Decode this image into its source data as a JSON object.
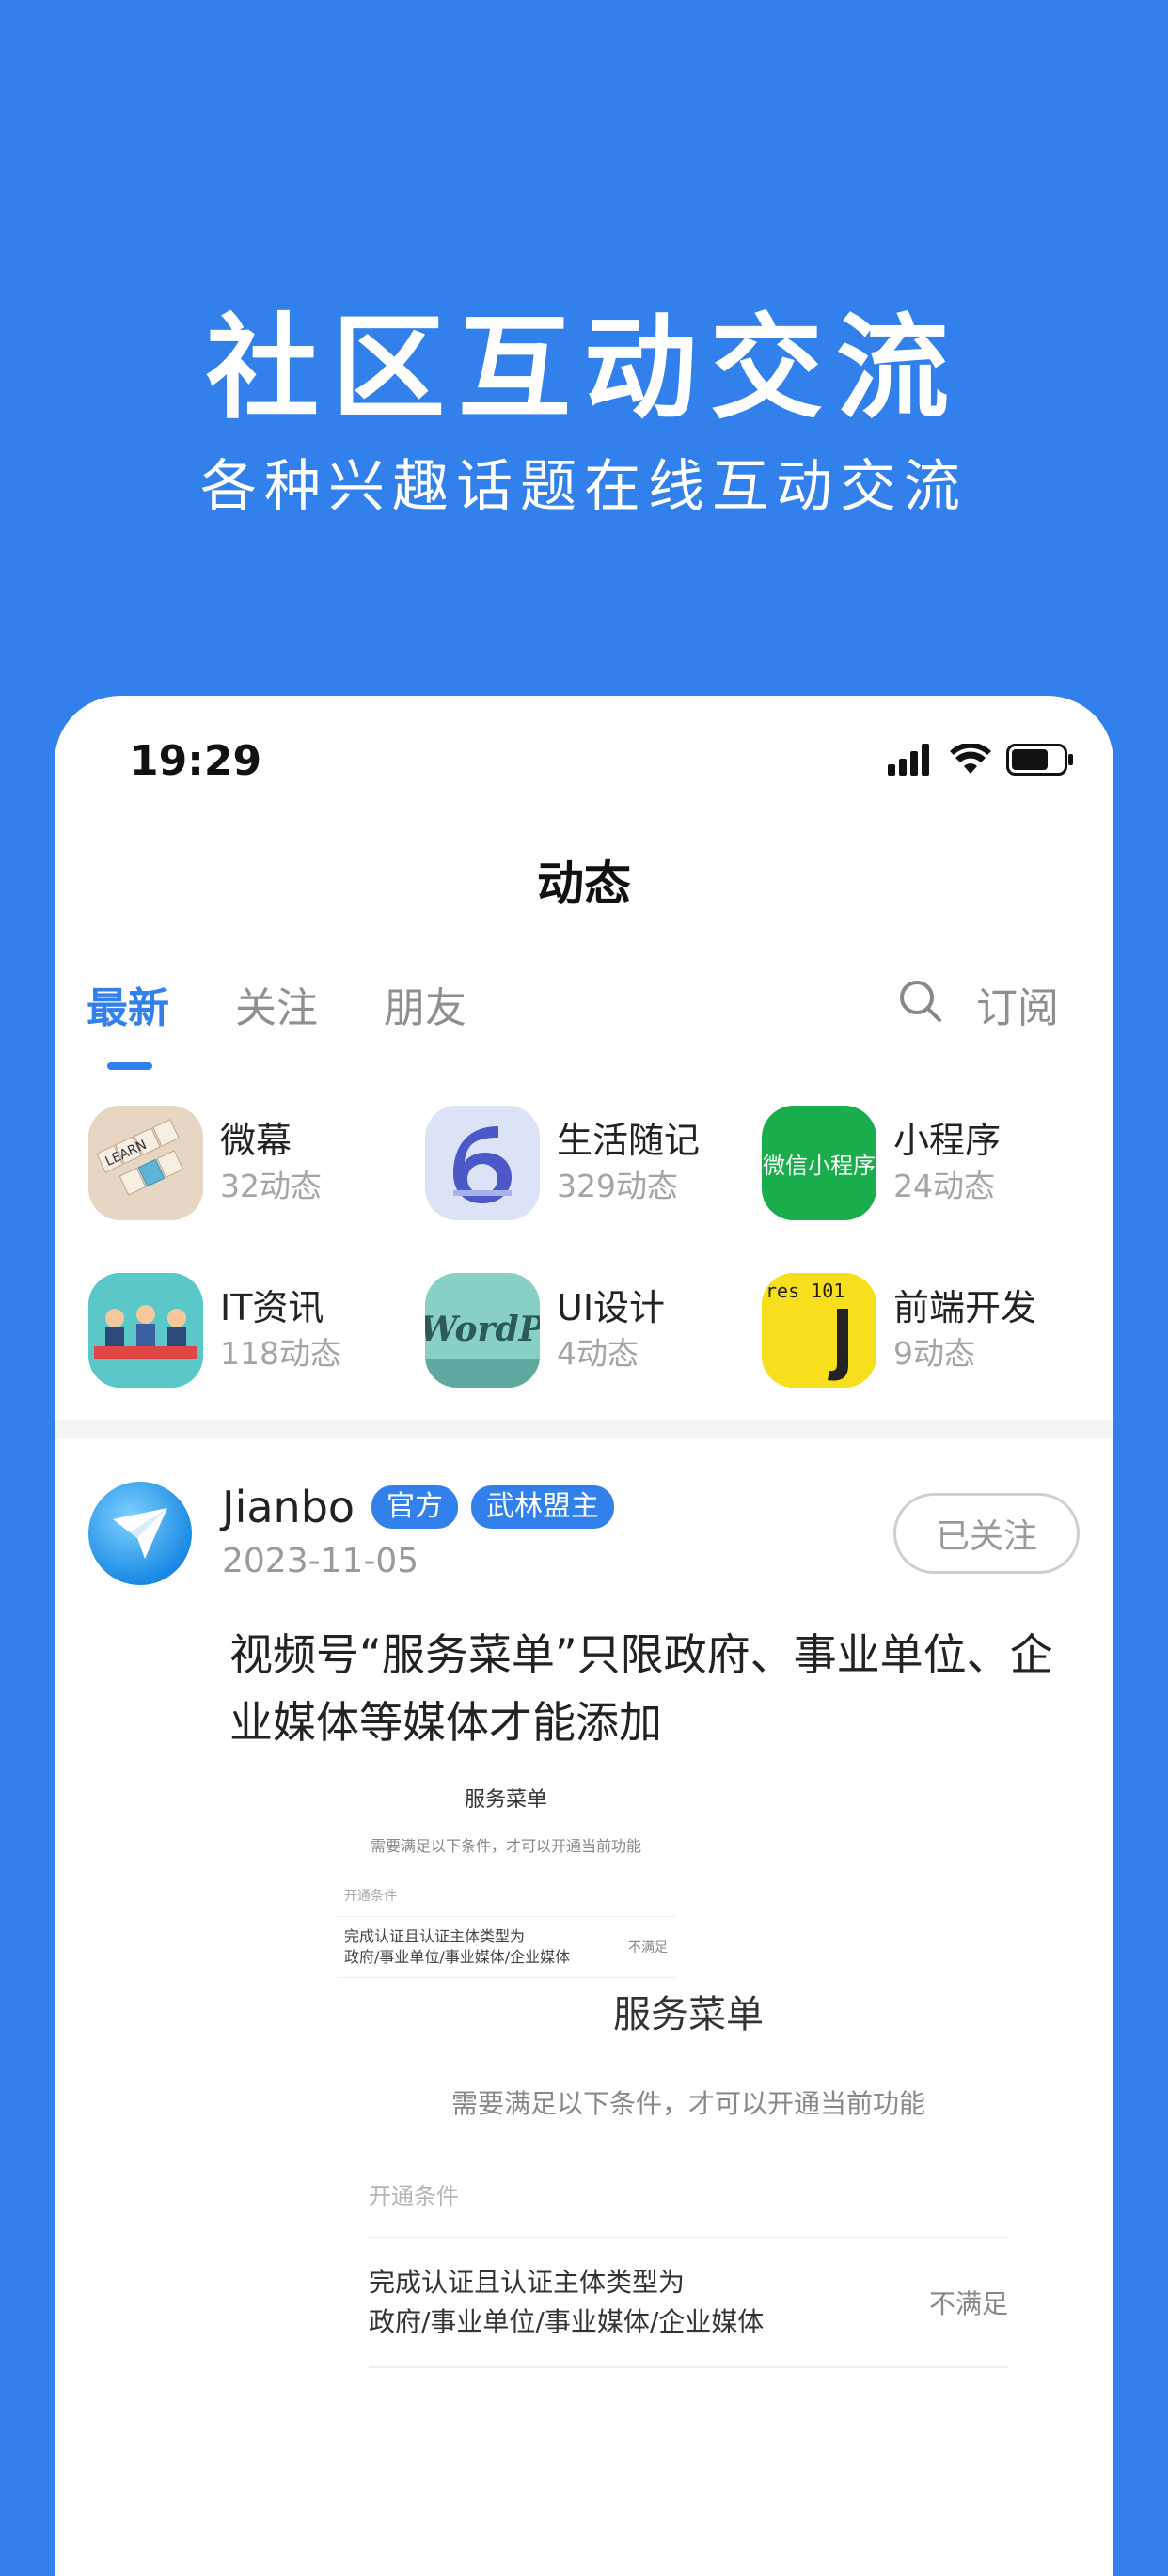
{
  "hero": {
    "title": "社区互动交流",
    "subtitle": "各种兴趣话题在线互动交流"
  },
  "status_bar": {
    "time": "19:29"
  },
  "nav": {
    "title": "动态"
  },
  "tabs": [
    {
      "label": "最新",
      "active": true
    },
    {
      "label": "关注",
      "active": false
    },
    {
      "label": "朋友",
      "active": false
    }
  ],
  "subscribe_label": "订阅",
  "topics": [
    {
      "name": "微幕",
      "count": "32动态"
    },
    {
      "name": "生活随记",
      "count": "329动态"
    },
    {
      "name": "小程序",
      "count": "24动态"
    },
    {
      "name": "IT资讯",
      "count": "118动态"
    },
    {
      "name": "UI设计",
      "count": "4动态"
    },
    {
      "name": "前端开发",
      "count": "9动态"
    }
  ],
  "topic_icons": {
    "weimu": "LEARN",
    "miniapp": "微信小程序",
    "ui": "WordPre",
    "frontend": "res 101"
  },
  "post": {
    "author": "Jianbo",
    "badges": [
      "官方",
      "武林盟主"
    ],
    "date": "2023-11-05",
    "follow_label": "已关注",
    "text": "视频号“服务菜单”只限政府、事业单位、企业媒体等媒体才能添加",
    "image": {
      "title": "服务菜单",
      "subtitle": "需要满足以下条件，才可以开通当前功能",
      "section_label": "开通条件",
      "condition_line1": "完成认证且认证主体类型为",
      "condition_line2": "政府/事业单位/事业媒体/企业媒体",
      "status": "不满足"
    }
  },
  "colors": {
    "accent": "#3280EC",
    "background": "#3280EC"
  }
}
